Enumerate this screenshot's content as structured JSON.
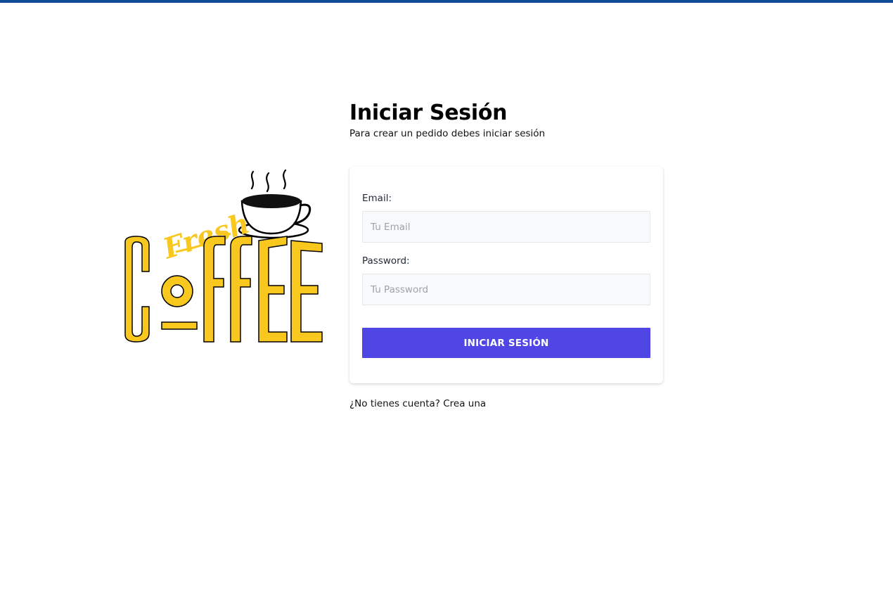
{
  "colors": {
    "top_bar": "#0f4c96",
    "accent": "#4f46e5",
    "logo_yellow": "#f9c81f"
  },
  "logo": {
    "script_text": "Fresh",
    "main_text": "COFFEE",
    "icon": "coffee-cup-icon"
  },
  "header": {
    "title": "Iniciar Sesión",
    "subtitle": "Para crear un pedido debes iniciar sesión"
  },
  "form": {
    "email_label": "Email:",
    "email_placeholder": "Tu Email",
    "email_value": "",
    "password_label": "Password:",
    "password_placeholder": "Tu Password",
    "password_value": "",
    "submit_label": "INICIAR SESIÓN"
  },
  "footer": {
    "register_link": "¿No tienes cuenta? Crea una"
  }
}
